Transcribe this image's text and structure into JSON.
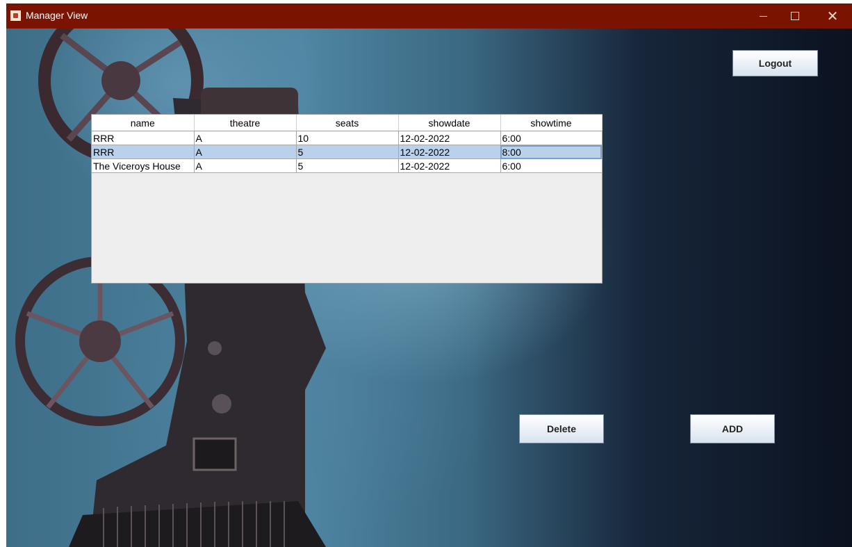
{
  "window": {
    "title": "Manager View"
  },
  "icons": {
    "app": "java-app-icon",
    "minimize": "minimize-icon",
    "maximize": "maximize-icon",
    "close": "close-icon"
  },
  "colors": {
    "titlebar": "#7a1300",
    "selection": "#b9d1ea"
  },
  "table": {
    "columns": [
      "name",
      "theatre",
      "seats",
      "showdate",
      "showtime"
    ],
    "rows": [
      [
        "RRR",
        "A",
        "10",
        "12-02-2022",
        "6:00"
      ],
      [
        "RRR",
        "A",
        "5",
        "12-02-2022",
        "8:00"
      ],
      [
        "The Viceroys House",
        "A",
        "5",
        "12-02-2022",
        "6:00"
      ]
    ],
    "selected_row": 1
  },
  "buttons": {
    "logout": "Logout",
    "delete": "Delete",
    "add": "ADD"
  }
}
